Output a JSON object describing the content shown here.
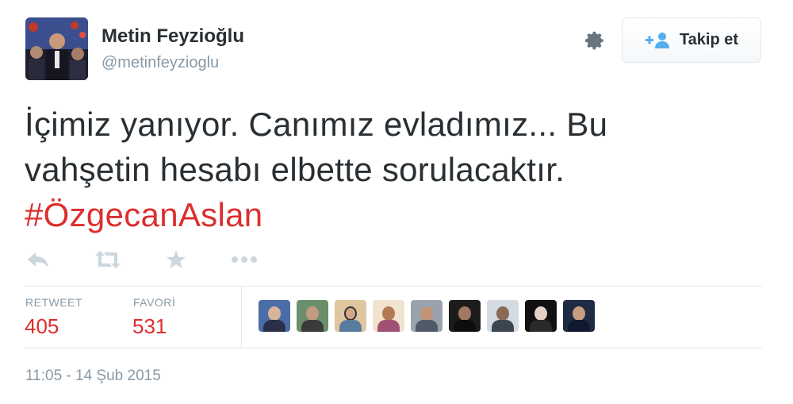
{
  "user": {
    "display_name": "Metin Feyzioğlu",
    "handle": "@metinfeyzioglu"
  },
  "header": {
    "settings_icon": "gear-icon",
    "follow_icon": "add-user-icon",
    "follow_label": "Takip et"
  },
  "tweet": {
    "line1": "İçimiz yanıyor. Canımız evladımız... Bu",
    "line2": "vahşetin hesabı elbette sorulacaktır.",
    "hashtag": "#ÖzgecanAslan"
  },
  "actions": {
    "reply_icon": "reply-icon",
    "retweet_icon": "retweet-icon",
    "favorite_icon": "star-icon",
    "more_icon": "more-dots-icon"
  },
  "stats": {
    "retweet_label": "RETWEET",
    "retweet_count": "405",
    "favorite_label": "FAVORİ",
    "favorite_count": "531"
  },
  "timestamp": "11:05 - 14 Şub 2015",
  "colors": {
    "hashtag": "#dd2e2e",
    "count": "#dd2e2e",
    "secondary_text": "#8899a6",
    "primary_text": "#292f33",
    "follow_icon": "#55acee"
  }
}
